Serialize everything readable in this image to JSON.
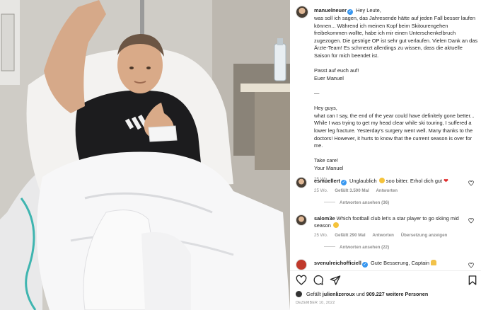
{
  "post": {
    "username": "manuelneuer",
    "caption_intro": "Hey Leute,",
    "caption": "was soll ich sagen, das Jahresende hätte auf jeden Fall besser laufen können... Während ich meinen Kopf beim Skitourengehen freibekommen wollte, habe ich mir einen Unterschenkelbruch zugezogen. Die gestrige OP ist sehr gut verlaufen. Vielen Dank an das Ärzte-Team! Es schmerzt allerdings zu wissen, dass die aktuelle Saison für mich beendet ist.\n\nPasst auf euch auf!\nEuer Manuel\n\n—\n\nHey guys,\nwhat can I say, the end of the year could have definitely gone better... While I was trying to get my head clear while ski touring, I suffered a lower leg fracture. Yesterday's surgery went well. Many thanks to the doctors! However, it hurts to know that the current season is over for me.\n\nTake care!\nYour Manuel",
    "age": "25 Wo."
  },
  "comments": [
    {
      "username": "esmuellert",
      "text_a": "Unglaublich",
      "text_b": "soo bitter. Erhol dich gut",
      "age": "25 Wo.",
      "likes": "Gefällt 3.500 Mal",
      "reply": "Antworten",
      "view_replies": "Antworten ansehen (36)"
    },
    {
      "username": "salom3e",
      "text_a": "Which football club let's a star player to go skiing mid season",
      "age": "25 Wo.",
      "likes": "Gefällt 290 Mal",
      "reply": "Antworten",
      "translate": "Übersetzung anzeigen",
      "view_replies": "Antworten ansehen (22)"
    },
    {
      "username": "svenulreichofficiell",
      "text_a": "Gute Besserung, Captain"
    }
  ],
  "likes": {
    "prefix": "Gefällt",
    "user": "julienlizeroux",
    "connector": "und",
    "others": "909.227 weitere Personen"
  },
  "date": "DEZEMBER 10, 2022",
  "colors": {
    "verified": "#3897f0",
    "muted": "#8e8e8e",
    "heart_emoji": "#e02a2a"
  },
  "icons": [
    "heart-icon",
    "comment-icon",
    "share-icon",
    "bookmark-icon"
  ]
}
